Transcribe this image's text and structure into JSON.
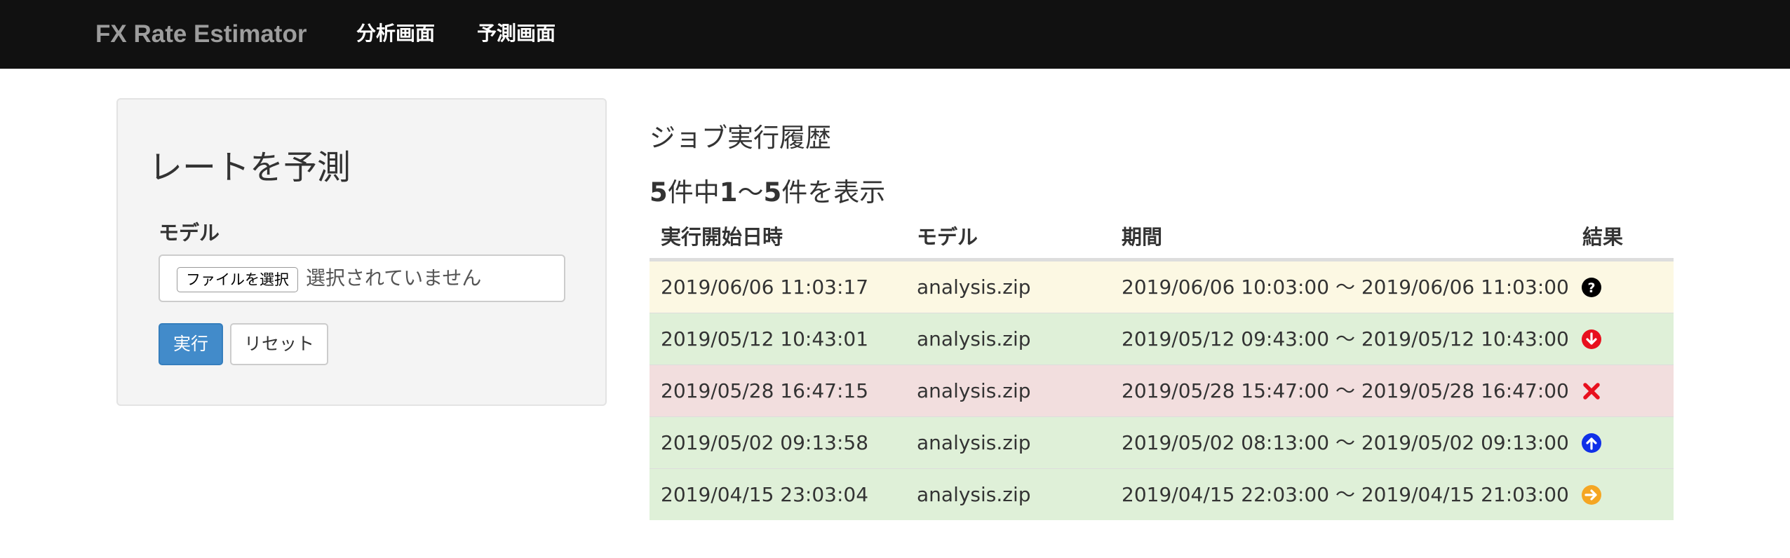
{
  "navbar": {
    "brand": "FX Rate Estimator",
    "links": [
      "分析画面",
      "予測画面"
    ]
  },
  "form": {
    "title": "レートを予測",
    "model_label": "モデル",
    "file_button": "ファイルを選択",
    "file_status": "選択されていません",
    "run_button": "実行",
    "reset_button": "リセット"
  },
  "history": {
    "title": "ジョブ実行履歴",
    "count": {
      "total": "5",
      "text1": "件中",
      "from": "1",
      "sep": "〜",
      "to": "5",
      "text2": "件を表示"
    },
    "columns": [
      "実行開始日時",
      "モデル",
      "期間",
      "結果"
    ],
    "rows": [
      {
        "started": "2019/06/06 11:03:17",
        "model": "analysis.zip",
        "period": "2019/06/06 10:03:00 〜 2019/06/06 11:03:00",
        "result_icon": "question-icon",
        "status": "warning",
        "icon_color": "#000000"
      },
      {
        "started": "2019/05/12 10:43:01",
        "model": "analysis.zip",
        "period": "2019/05/12 09:43:00 〜 2019/05/12 10:43:00",
        "result_icon": "arrow-down-icon",
        "status": "success",
        "icon_color": "#e8101e"
      },
      {
        "started": "2019/05/28 16:47:15",
        "model": "analysis.zip",
        "period": "2019/05/28 15:47:00 〜 2019/05/28 16:47:00",
        "result_icon": "close-icon",
        "status": "danger",
        "icon_color": "#e8101e"
      },
      {
        "started": "2019/05/02 09:13:58",
        "model": "analysis.zip",
        "period": "2019/05/02 08:13:00 〜 2019/05/02 09:13:00",
        "result_icon": "arrow-up-icon",
        "status": "success",
        "icon_color": "#1030e8"
      },
      {
        "started": "2019/04/15 23:03:04",
        "model": "analysis.zip",
        "period": "2019/04/15 22:03:00 〜 2019/04/15 21:03:00",
        "result_icon": "arrow-right-icon",
        "status": "success",
        "icon_color": "#f5a623"
      }
    ]
  }
}
